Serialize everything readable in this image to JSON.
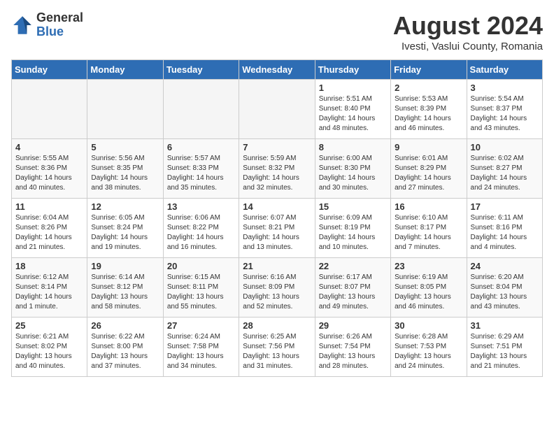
{
  "logo": {
    "general": "General",
    "blue": "Blue"
  },
  "title": {
    "month_year": "August 2024",
    "location": "Ivesti, Vaslui County, Romania"
  },
  "days_of_week": [
    "Sunday",
    "Monday",
    "Tuesday",
    "Wednesday",
    "Thursday",
    "Friday",
    "Saturday"
  ],
  "weeks": [
    [
      {
        "num": "",
        "empty": true
      },
      {
        "num": "",
        "empty": true
      },
      {
        "num": "",
        "empty": true
      },
      {
        "num": "",
        "empty": true
      },
      {
        "num": "1",
        "info": "Sunrise: 5:51 AM\nSunset: 8:40 PM\nDaylight: 14 hours and 48 minutes."
      },
      {
        "num": "2",
        "info": "Sunrise: 5:53 AM\nSunset: 8:39 PM\nDaylight: 14 hours and 46 minutes."
      },
      {
        "num": "3",
        "info": "Sunrise: 5:54 AM\nSunset: 8:37 PM\nDaylight: 14 hours and 43 minutes."
      }
    ],
    [
      {
        "num": "4",
        "info": "Sunrise: 5:55 AM\nSunset: 8:36 PM\nDaylight: 14 hours and 40 minutes."
      },
      {
        "num": "5",
        "info": "Sunrise: 5:56 AM\nSunset: 8:35 PM\nDaylight: 14 hours and 38 minutes."
      },
      {
        "num": "6",
        "info": "Sunrise: 5:57 AM\nSunset: 8:33 PM\nDaylight: 14 hours and 35 minutes."
      },
      {
        "num": "7",
        "info": "Sunrise: 5:59 AM\nSunset: 8:32 PM\nDaylight: 14 hours and 32 minutes."
      },
      {
        "num": "8",
        "info": "Sunrise: 6:00 AM\nSunset: 8:30 PM\nDaylight: 14 hours and 30 minutes."
      },
      {
        "num": "9",
        "info": "Sunrise: 6:01 AM\nSunset: 8:29 PM\nDaylight: 14 hours and 27 minutes."
      },
      {
        "num": "10",
        "info": "Sunrise: 6:02 AM\nSunset: 8:27 PM\nDaylight: 14 hours and 24 minutes."
      }
    ],
    [
      {
        "num": "11",
        "info": "Sunrise: 6:04 AM\nSunset: 8:26 PM\nDaylight: 14 hours and 21 minutes."
      },
      {
        "num": "12",
        "info": "Sunrise: 6:05 AM\nSunset: 8:24 PM\nDaylight: 14 hours and 19 minutes."
      },
      {
        "num": "13",
        "info": "Sunrise: 6:06 AM\nSunset: 8:22 PM\nDaylight: 14 hours and 16 minutes."
      },
      {
        "num": "14",
        "info": "Sunrise: 6:07 AM\nSunset: 8:21 PM\nDaylight: 14 hours and 13 minutes."
      },
      {
        "num": "15",
        "info": "Sunrise: 6:09 AM\nSunset: 8:19 PM\nDaylight: 14 hours and 10 minutes."
      },
      {
        "num": "16",
        "info": "Sunrise: 6:10 AM\nSunset: 8:17 PM\nDaylight: 14 hours and 7 minutes."
      },
      {
        "num": "17",
        "info": "Sunrise: 6:11 AM\nSunset: 8:16 PM\nDaylight: 14 hours and 4 minutes."
      }
    ],
    [
      {
        "num": "18",
        "info": "Sunrise: 6:12 AM\nSunset: 8:14 PM\nDaylight: 14 hours and 1 minute."
      },
      {
        "num": "19",
        "info": "Sunrise: 6:14 AM\nSunset: 8:12 PM\nDaylight: 13 hours and 58 minutes."
      },
      {
        "num": "20",
        "info": "Sunrise: 6:15 AM\nSunset: 8:11 PM\nDaylight: 13 hours and 55 minutes."
      },
      {
        "num": "21",
        "info": "Sunrise: 6:16 AM\nSunset: 8:09 PM\nDaylight: 13 hours and 52 minutes."
      },
      {
        "num": "22",
        "info": "Sunrise: 6:17 AM\nSunset: 8:07 PM\nDaylight: 13 hours and 49 minutes."
      },
      {
        "num": "23",
        "info": "Sunrise: 6:19 AM\nSunset: 8:05 PM\nDaylight: 13 hours and 46 minutes."
      },
      {
        "num": "24",
        "info": "Sunrise: 6:20 AM\nSunset: 8:04 PM\nDaylight: 13 hours and 43 minutes."
      }
    ],
    [
      {
        "num": "25",
        "info": "Sunrise: 6:21 AM\nSunset: 8:02 PM\nDaylight: 13 hours and 40 minutes."
      },
      {
        "num": "26",
        "info": "Sunrise: 6:22 AM\nSunset: 8:00 PM\nDaylight: 13 hours and 37 minutes."
      },
      {
        "num": "27",
        "info": "Sunrise: 6:24 AM\nSunset: 7:58 PM\nDaylight: 13 hours and 34 minutes."
      },
      {
        "num": "28",
        "info": "Sunrise: 6:25 AM\nSunset: 7:56 PM\nDaylight: 13 hours and 31 minutes."
      },
      {
        "num": "29",
        "info": "Sunrise: 6:26 AM\nSunset: 7:54 PM\nDaylight: 13 hours and 28 minutes."
      },
      {
        "num": "30",
        "info": "Sunrise: 6:28 AM\nSunset: 7:53 PM\nDaylight: 13 hours and 24 minutes."
      },
      {
        "num": "31",
        "info": "Sunrise: 6:29 AM\nSunset: 7:51 PM\nDaylight: 13 hours and 21 minutes."
      }
    ]
  ]
}
